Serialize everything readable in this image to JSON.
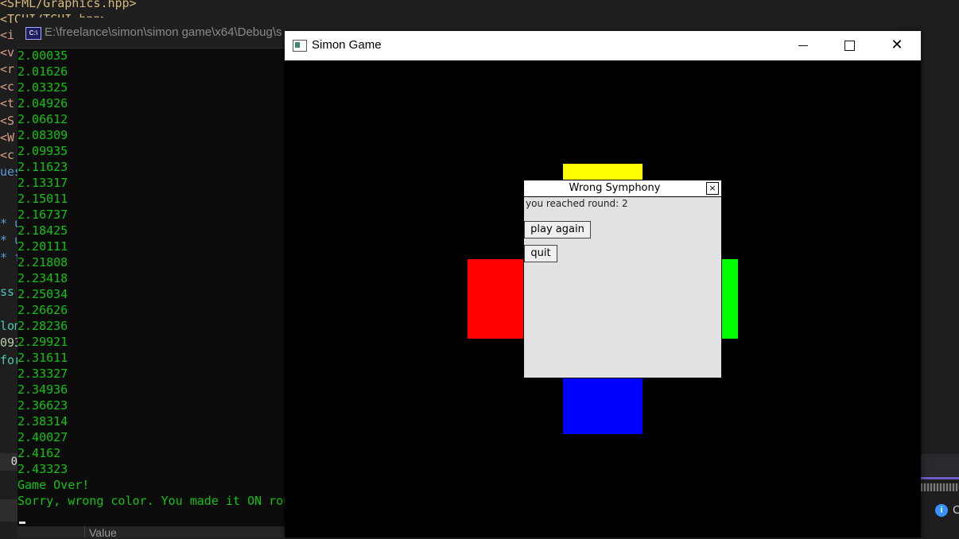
{
  "ide": {
    "code_fragments": [
      {
        "text": "<SFML/Graphics.hpp>",
        "color": "#d7ba7d"
      },
      {
        "text": "<TGUI/TGUI.hpp>",
        "color": "#d7ba7d"
      },
      {
        "text": "<i",
        "color": "#d69d85"
      },
      {
        "text": "<v",
        "color": "#d69d85"
      },
      {
        "text": "<r",
        "color": "#d69d85"
      },
      {
        "text": "<c",
        "color": "#d69d85"
      },
      {
        "text": "<t",
        "color": "#d69d85"
      },
      {
        "text": "<S",
        "color": "#d69d85"
      },
      {
        "text": "<W",
        "color": "#d69d85"
      },
      {
        "text": "<c",
        "color": "#d69d85"
      },
      {
        "text": "ues",
        "color": "#569cd6"
      },
      {
        "text": "",
        "color": "#d4d4d4"
      },
      {
        "text": "",
        "color": "#d4d4d4"
      },
      {
        "text": "* u",
        "color": "#569cd6"
      },
      {
        "text": "* u",
        "color": "#569cd6"
      },
      {
        "text": "* f",
        "color": "#569cd6"
      },
      {
        "text": "",
        "color": "#d4d4d4"
      },
      {
        "text": "ss",
        "color": "#4ec9b0"
      },
      {
        "text": "",
        "color": "#d4d4d4"
      },
      {
        "text": "lom",
        "color": "#4ec9b0"
      },
      {
        "text": "093",
        "color": "#b5cea8"
      },
      {
        "text": "for",
        "color": "#4ec9b0"
      },
      {
        "text": "",
        "color": "#d4d4d4"
      },
      {
        "text": "",
        "color": "#d4d4d4"
      },
      {
        "text": "",
        "color": "#d4d4d4"
      },
      {
        "text": "",
        "color": "#d4d4d4"
      },
      {
        "text": "",
        "color": "#d4d4d4"
      },
      {
        "text": "ue",
        "color": "#4ec9b0"
      }
    ],
    "status_number": "0",
    "info_text": "C",
    "value_column_header": "Value"
  },
  "console": {
    "title": "E:\\freelance\\simon\\simon game\\x64\\Debug\\s",
    "icon_label": "C:\\",
    "lines": [
      "2.00035",
      "2.01626",
      "2.03325",
      "2.04926",
      "2.06612",
      "2.08309",
      "2.09935",
      "2.11623",
      "2.13317",
      "2.15011",
      "2.16737",
      "2.18425",
      "2.20111",
      "2.21808",
      "2.23418",
      "2.25034",
      "2.26626",
      "2.28236",
      "2.29921",
      "2.31611",
      "2.33327",
      "2.34936",
      "2.36623",
      "2.38314",
      "2.40027",
      "2.4162",
      "2.43323",
      "Game Over!",
      "Sorry, wrong color. You made it ON rou"
    ],
    "text_color": "#13c113"
  },
  "simon_window": {
    "title": "Simon Game",
    "pads": {
      "yellow": "#ffff00",
      "red": "#ff0000",
      "green": "#00ff00",
      "blue": "#0000ff"
    }
  },
  "dialog": {
    "title": "Wrong Symphony",
    "close_glyph": "×",
    "message": "you reached round: 2",
    "play_again_label": "play again",
    "quit_label": "quit"
  }
}
